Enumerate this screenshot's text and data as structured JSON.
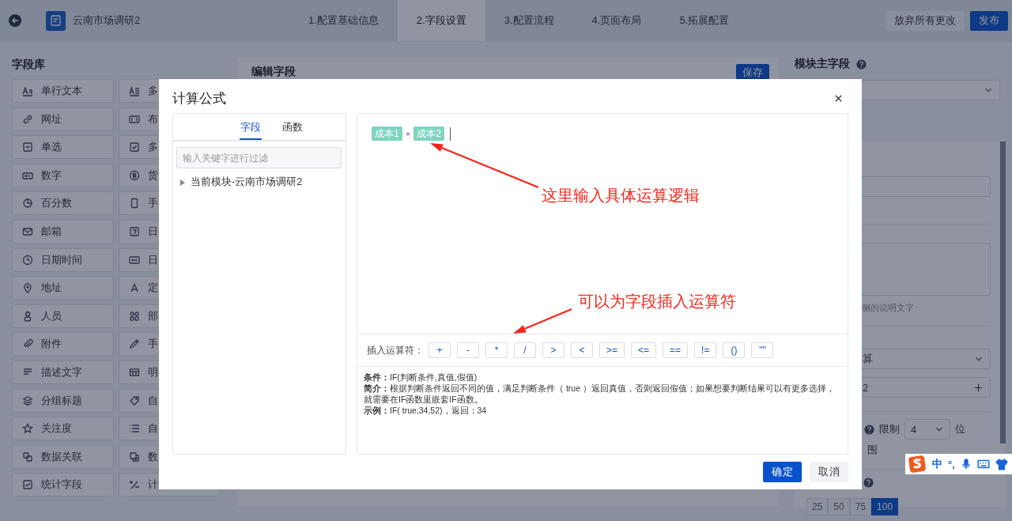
{
  "topbar": {
    "app_title": "云南市场调研2",
    "steps": [
      {
        "label": "1.配置基础信息",
        "selected": false
      },
      {
        "label": "2.字段设置",
        "selected": true
      },
      {
        "label": "3.配置流程",
        "selected": false
      },
      {
        "label": "4.页面布局",
        "selected": false
      },
      {
        "label": "5.拓展配置",
        "selected": false
      }
    ],
    "buttons": [
      {
        "label": "放弃所有更改",
        "kind": "secondary"
      },
      {
        "label": "发布",
        "kind": "primary"
      }
    ]
  },
  "field_library": {
    "title": "字段库",
    "items": [
      {
        "left": "单行文本",
        "right": "多"
      },
      {
        "left": "网址",
        "right": "布"
      },
      {
        "left": "单选",
        "right": "多"
      },
      {
        "left": "数字",
        "right": "货"
      },
      {
        "left": "百分数",
        "right": "手"
      },
      {
        "left": "邮箱",
        "right": "日"
      },
      {
        "left": "日期时间",
        "right": "日"
      },
      {
        "left": "地址",
        "right": "定"
      },
      {
        "left": "人员",
        "right": "部"
      },
      {
        "left": "附件",
        "right": "手"
      },
      {
        "left": "描述文字",
        "right": "明"
      },
      {
        "left": "分组标题",
        "right": "自"
      },
      {
        "left": "关注度",
        "right": "自"
      },
      {
        "left": "数据关联",
        "right": "数"
      },
      {
        "left": "统计字段",
        "right": "计"
      }
    ]
  },
  "editor_panel": {
    "title": "编辑字段",
    "save_button": "保存"
  },
  "properties_panel": {
    "title": "模块主字段",
    "hint": "侧的说明文字",
    "select_value": "算",
    "number_value": "2",
    "limit_label": "限制",
    "limit_value": "4",
    "unit": "位",
    "range_text": "围",
    "segments": [
      {
        "label": "25",
        "selected": false
      },
      {
        "label": "50",
        "selected": false
      },
      {
        "label": "75",
        "selected": false
      },
      {
        "label": "100",
        "selected": true
      }
    ]
  },
  "dialog": {
    "title": "计算公式",
    "tabs": [
      {
        "label": "字段",
        "selected": true
      },
      {
        "label": "函数",
        "selected": false
      }
    ],
    "filter_placeholder": "输入关键字进行过滤",
    "tree": [
      {
        "label": "当前模块-云南市场调研2",
        "expanded": false
      }
    ],
    "formula": [
      {
        "kind": "field",
        "text": "成本1"
      },
      {
        "kind": "operator",
        "text": "+"
      },
      {
        "kind": "field",
        "text": "成本2"
      }
    ],
    "annotations": [
      {
        "text": "这里输入具体运算逻辑"
      },
      {
        "text": "可以为字段插入运算符"
      }
    ],
    "operators_label": "插入运算符：",
    "operators": [
      "+",
      "-",
      "*",
      "/",
      ">",
      "<",
      ">=",
      "<=",
      "==",
      "!=",
      "()",
      "\"\""
    ],
    "description": [
      "**条件：**IF(判断条件,真值,假值)",
      "**简介：**根据判断条件返回不同的值，满足判断条件（ true ）返回真值，否则返回假值；如果想要判断结果可以有更多选择，就需要在IF函数里嵌套IF函数。",
      "**示例：**IF( true,34,52)，返回：34"
    ],
    "buttons": [
      {
        "label": "确定",
        "kind": "primary"
      },
      {
        "label": "取消",
        "kind": "secondary"
      }
    ]
  },
  "ime_bar": {
    "items": [
      "中",
      "°,"
    ]
  }
}
